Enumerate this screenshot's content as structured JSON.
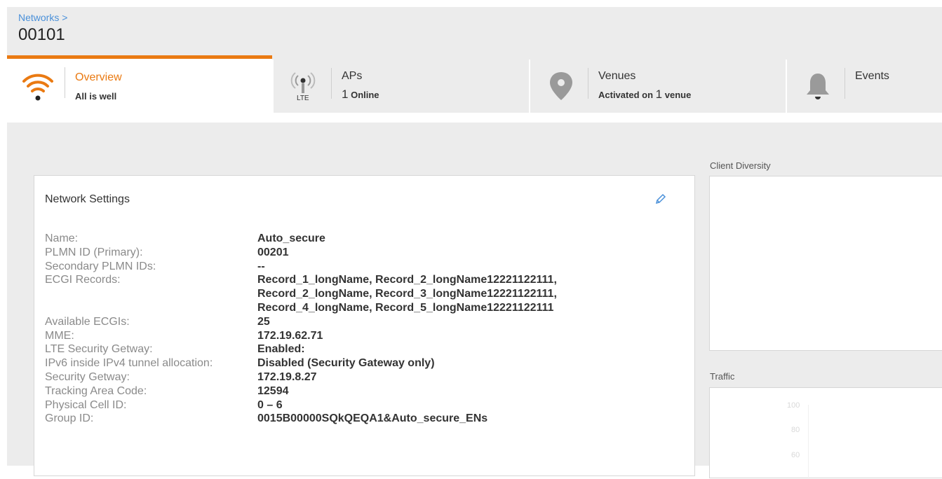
{
  "breadcrumb": "Networks >",
  "title": "00101",
  "tabs": [
    {
      "label": "Overview",
      "sub": "All is well",
      "icon": "wifi-icon",
      "active": true
    },
    {
      "label": "APs",
      "sub_num": "1",
      "sub_text": "Online",
      "icon": "lte-antenna-icon",
      "icon_text": "LTE"
    },
    {
      "label": "Venues",
      "sub_pre": "Activated on",
      "sub_num": "1",
      "sub_post": "venue",
      "icon": "location-pin-icon"
    },
    {
      "label": "Events",
      "icon": "bell-icon"
    }
  ],
  "settings": {
    "title": "Network Settings",
    "rows": [
      {
        "k": "Name:",
        "v": "Auto_secure"
      },
      {
        "k": "PLMN ID (Primary):",
        "v": "00201"
      },
      {
        "k": "Secondary PLMN IDs:",
        "v": "--"
      },
      {
        "k": "ECGI Records:",
        "v": "Record_1_longName, Record_2_longName12221122111,"
      },
      {
        "k": "",
        "v": "Record_2_longName, Record_3_longName12221122111,"
      },
      {
        "k": "",
        "v": "Record_4_longName, Record_5_longName12221122111"
      },
      {
        "k": "Available ECGIs:",
        "v": "25"
      },
      {
        "k": "MME:",
        "v": "172.19.62.71"
      },
      {
        "k": "LTE Security Getway:",
        "v": "Enabled:"
      },
      {
        "k": "IPv6 inside IPv4 tunnel allocation:",
        "v": "Disabled (Security Gateway only)"
      },
      {
        "k": "Security Getway:",
        "v": "172.19.8.27"
      },
      {
        "k": "Tracking Area Code:",
        "v": "12594"
      },
      {
        "k": "Physical Cell ID:",
        "v": "0 – 6"
      },
      {
        "k": "Group ID:",
        "v": "0015B00000SQkQEQA1&Auto_secure_ENs"
      }
    ]
  },
  "client_diversity": {
    "title": "Client Diversity"
  },
  "traffic": {
    "title": "Traffic",
    "ticks": [
      "100",
      "80",
      "60"
    ]
  },
  "colors": {
    "accent": "#ea7a12",
    "link": "#4a90d9"
  }
}
